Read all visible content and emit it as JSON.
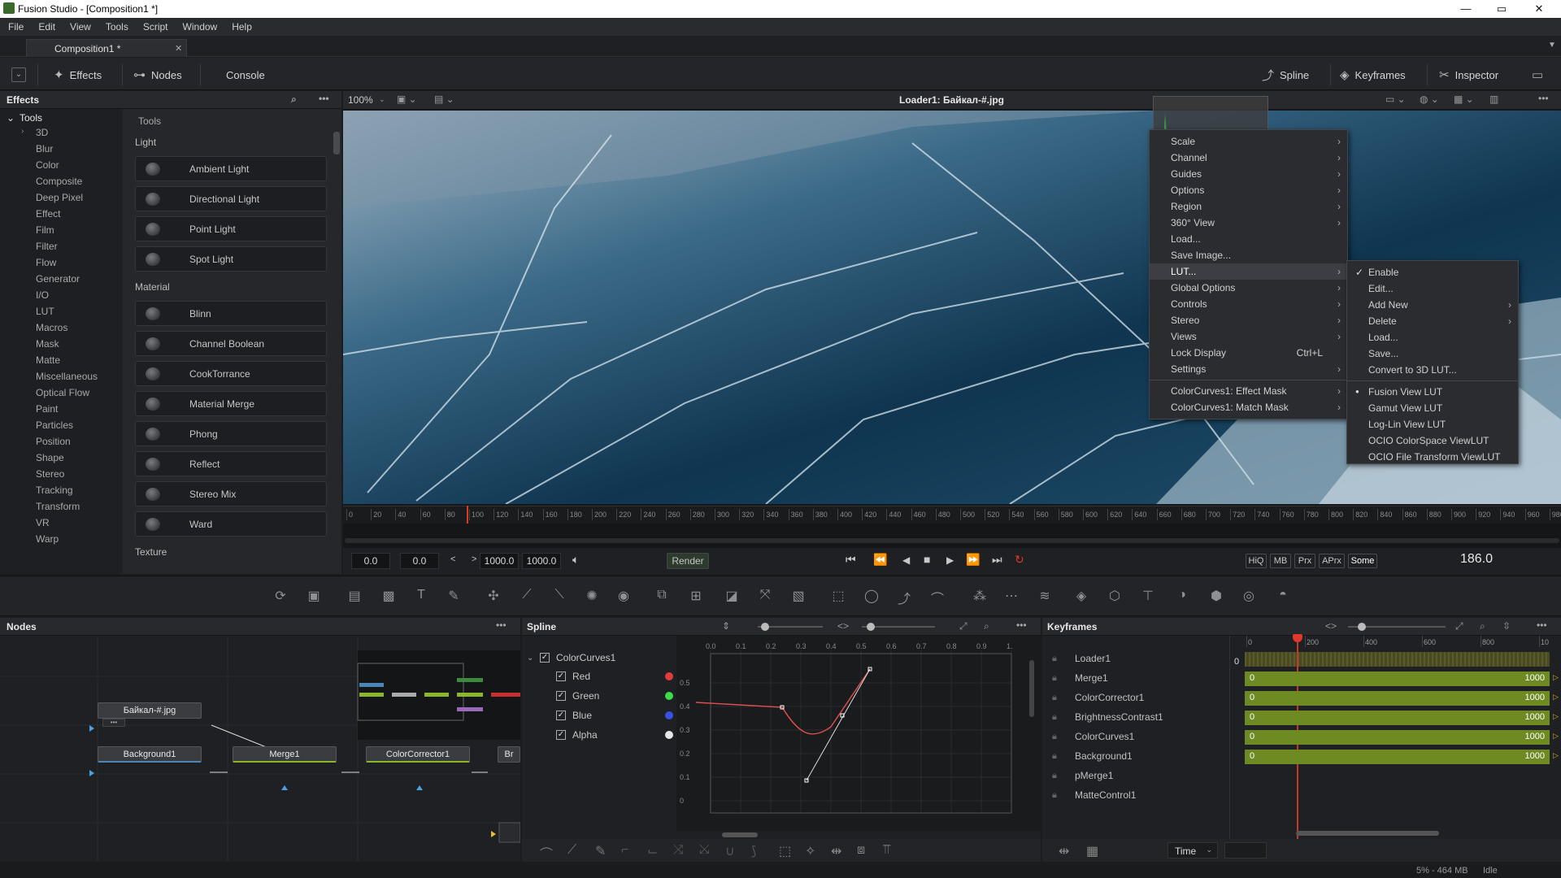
{
  "window": {
    "title": "Fusion Studio - [Composition1 *]",
    "min": "—",
    "max": "▭",
    "close": "✕"
  },
  "menubar": [
    "File",
    "Edit",
    "View",
    "Tools",
    "Script",
    "Window",
    "Help"
  ],
  "doc_tab": {
    "label": "Composition1 *",
    "close": "✕"
  },
  "toolbar": {
    "effects": "Effects",
    "nodes": "Nodes",
    "console": "Console",
    "spline": "Spline",
    "keyframes": "Keyframes",
    "inspector": "Inspector"
  },
  "effects": {
    "title": "Effects",
    "tree_root": "Tools",
    "tree": [
      "3D",
      "Blur",
      "Color",
      "Composite",
      "Deep Pixel",
      "Effect",
      "Film",
      "Filter",
      "Flow",
      "Generator",
      "I/O",
      "LUT",
      "Macros",
      "Mask",
      "Matte",
      "Miscellaneous",
      "Optical Flow",
      "Paint",
      "Particles",
      "Position",
      "Shape",
      "Stereo",
      "Tracking",
      "Transform",
      "VR",
      "Warp"
    ],
    "panel_title": "Tools",
    "sections": [
      {
        "name": "Light",
        "items": [
          "Ambient Light",
          "Directional Light",
          "Point Light",
          "Spot Light"
        ]
      },
      {
        "name": "Material",
        "items": [
          "Blinn",
          "Channel Boolean",
          "CookTorrance",
          "Material Merge",
          "Phong",
          "Reflect",
          "Stereo Mix",
          "Ward"
        ]
      },
      {
        "name": "Texture",
        "items": []
      }
    ]
  },
  "viewer": {
    "zoom": "100%",
    "title": "Loader1: Байкал-#.jpg",
    "ruler": [
      "0",
      "20",
      "40",
      "60",
      "80",
      "100",
      "120",
      "140",
      "160",
      "180",
      "200",
      "220",
      "240",
      "260",
      "280",
      "300",
      "320",
      "340",
      "360",
      "380",
      "400",
      "420",
      "440",
      "460",
      "480",
      "500",
      "520",
      "540",
      "560",
      "580",
      "600",
      "620",
      "640",
      "660",
      "680",
      "700",
      "720",
      "740",
      "760",
      "780",
      "800",
      "820",
      "840",
      "860",
      "880",
      "900",
      "920",
      "940",
      "960",
      "980"
    ],
    "playhead_frame": 186
  },
  "transport": {
    "start": "0.0",
    "render_start": "0.0",
    "render_end": "1000.0",
    "end": "1000.0",
    "render": "Render",
    "hiq": "HiQ",
    "mb": "MB",
    "prx": "Prx",
    "aprx": "APrx",
    "some": "Some",
    "current": "186.0"
  },
  "context_menu": {
    "items": [
      {
        "l": "Scale",
        "sub": true
      },
      {
        "l": "Channel",
        "sub": true
      },
      {
        "l": "Guides",
        "sub": true
      },
      {
        "l": "Options",
        "sub": true
      },
      {
        "l": "Region",
        "sub": true
      },
      {
        "l": "360° View",
        "sub": true
      },
      {
        "l": "Load...",
        "sub": false
      },
      {
        "l": "Save Image...",
        "sub": false
      },
      {
        "l": "LUT...",
        "sub": true,
        "active": true
      },
      {
        "l": "Global Options",
        "sub": true
      },
      {
        "l": "Controls",
        "sub": true
      },
      {
        "l": "Stereo",
        "sub": true
      },
      {
        "l": "Views",
        "sub": true
      },
      {
        "l": "Lock Display",
        "sub": false,
        "shortcut": "Ctrl+L"
      },
      {
        "l": "Settings",
        "sub": true
      },
      {
        "l": "ColorCurves1: Effect Mask",
        "sub": true
      },
      {
        "l": "ColorCurves1: Match Mask",
        "sub": true
      }
    ]
  },
  "lut_menu": {
    "items": [
      {
        "l": "Enable",
        "check": true
      },
      {
        "l": "Edit..."
      },
      {
        "l": "Add New",
        "sub": true
      },
      {
        "l": "Delete",
        "sub": true
      },
      {
        "l": "Load..."
      },
      {
        "l": "Save..."
      },
      {
        "l": "Convert to 3D LUT..."
      },
      {
        "l": "Fusion View LUT",
        "dot": true
      },
      {
        "l": "Gamut View LUT"
      },
      {
        "l": "Log-Lin View LUT"
      },
      {
        "l": "OCIO ColorSpace ViewLUT"
      },
      {
        "l": "OCIO File Transform ViewLUT"
      }
    ]
  },
  "nodes": {
    "title": "Nodes",
    "n_loader": "Байкал-#.jpg",
    "n_bg": "Background1",
    "n_merge": "Merge1",
    "n_cc": "ColorCorrector1",
    "n_br": "Br"
  },
  "spline": {
    "title": "Spline",
    "root": "ColorCurves1",
    "channels": [
      {
        "name": "Red",
        "color": "#e23b3b"
      },
      {
        "name": "Green",
        "color": "#3ddc4a"
      },
      {
        "name": "Blue",
        "color": "#3a4ee8"
      },
      {
        "name": "Alpha",
        "color": "#e6e6e6"
      }
    ],
    "xticks": [
      "0.0",
      "0.1",
      "0.2",
      "0.3",
      "0.4",
      "0.5",
      "0.6",
      "0.7",
      "0.8",
      "0.9",
      "1."
    ],
    "yticks": [
      "0.5",
      "0.4",
      "0.3",
      "0.2",
      "0.1",
      "0"
    ]
  },
  "keyframes": {
    "title": "Keyframes",
    "ticks": [
      "0",
      "200",
      "400",
      "600",
      "800",
      "10"
    ],
    "zero": "0",
    "rows": [
      {
        "name": "Loader1"
      },
      {
        "name": "Merge1",
        "start": "0",
        "end": "1000"
      },
      {
        "name": "ColorCorrector1",
        "start": "0",
        "end": "1000"
      },
      {
        "name": "BrightnessContrast1",
        "start": "0",
        "end": "1000"
      },
      {
        "name": "ColorCurves1",
        "start": "0",
        "end": "1000"
      },
      {
        "name": "Background1",
        "start": "0",
        "end": "1000"
      },
      {
        "name": "pMerge1"
      },
      {
        "name": "MatteControl1"
      }
    ],
    "time_label": "Time"
  },
  "status": {
    "memory": "5% - 464 MB",
    "state": "Idle"
  },
  "colors": {
    "accent": "#e0392b",
    "kf_bar": "#6e8a22"
  }
}
